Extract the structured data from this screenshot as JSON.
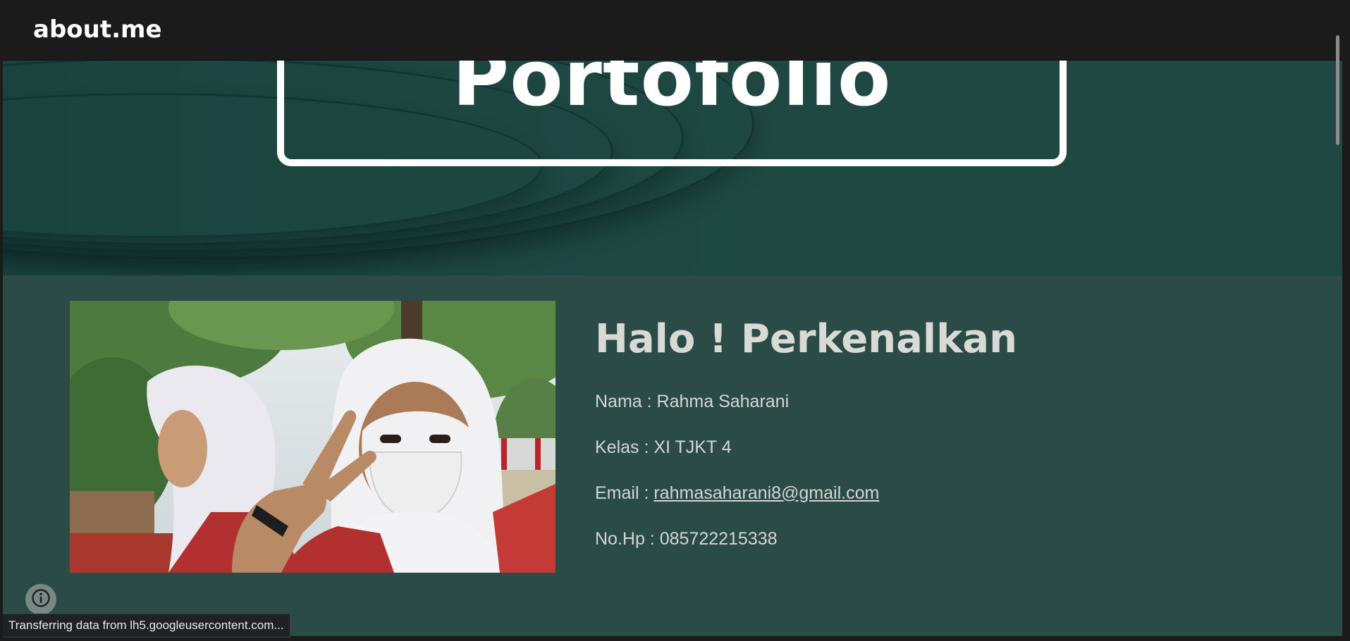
{
  "navbar": {
    "brand": "about.me"
  },
  "hero": {
    "title": "Portofolio"
  },
  "about": {
    "heading": "Halo ! Perkenalkan",
    "name_label": "Nama : ",
    "name_value": "Rahma Saharani",
    "class_label": "Kelas : ",
    "class_value": "XI TJKT 4",
    "email_label": "Email : ",
    "email_value": "rahmasaharani8@gmail.com",
    "phone_label": "No.Hp : ",
    "phone_value": "085722215338"
  },
  "browser": {
    "status_text": "Transferring data from lh5.googleusercontent.com..."
  },
  "icons": {
    "info": "info-icon"
  },
  "colors": {
    "navbar_bg": "#1b1b1b",
    "hero_bg": "#1f4843",
    "section_bg": "#2b4b47",
    "text_light": "#d9d9d6",
    "title_white": "#ffffff"
  }
}
